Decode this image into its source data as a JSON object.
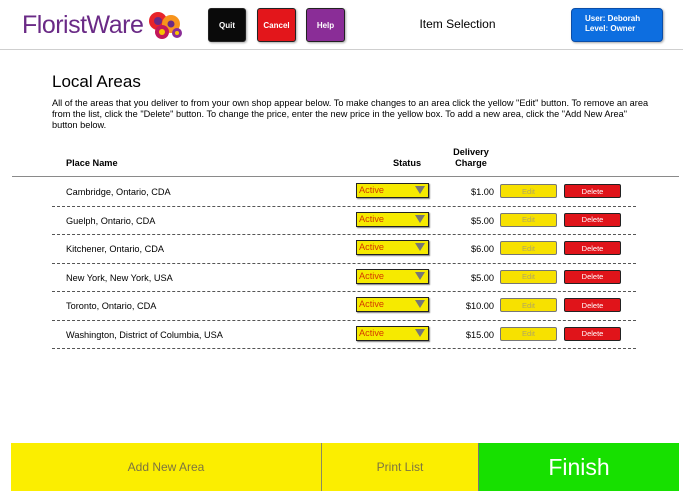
{
  "header": {
    "logo_text": "FloristWare",
    "quit_label": "Quit",
    "cancel_label": "Cancel",
    "help_label": "Help",
    "page_heading": "Item Selection",
    "user_line": "User: Deborah",
    "level_line": "Level: Owner"
  },
  "main": {
    "title": "Local Areas",
    "instructions": "All of the areas that you deliver to from your own shop appear below. To make changes to an area click the yellow \"Edit\" button. To remove an area from the list, click the \"Delete\" button. To change the price, enter the new price in the yellow box. To add a new area, click the \"Add New Area\" button below.",
    "columns": {
      "place": "Place Name",
      "status": "Status",
      "delivery_line1": "Delivery",
      "delivery_line2": "Charge"
    },
    "rows": [
      {
        "place": "Cambridge, Ontario, CDA",
        "status": "Active",
        "charge": "$1.00",
        "edit": "Edit",
        "delete": "Delete"
      },
      {
        "place": "Guelph, Ontario, CDA",
        "status": "Active",
        "charge": "$5.00",
        "edit": "Edit",
        "delete": "Delete"
      },
      {
        "place": "Kitchener, Ontario, CDA",
        "status": "Active",
        "charge": "$6.00",
        "edit": "Edit",
        "delete": "Delete"
      },
      {
        "place": "New York, New York, USA",
        "status": "Active",
        "charge": "$5.00",
        "edit": "Edit",
        "delete": "Delete"
      },
      {
        "place": "Toronto, Ontario, CDA",
        "status": "Active",
        "charge": "$10.00",
        "edit": "Edit",
        "delete": "Delete"
      },
      {
        "place": "Washington, District of Columbia, USA",
        "status": "Active",
        "charge": "$15.00",
        "edit": "Edit",
        "delete": "Delete"
      }
    ]
  },
  "footer": {
    "add_label": "Add New Area",
    "print_label": "Print List",
    "finish_label": "Finish"
  },
  "colors": {
    "brand_purple": "#6a2a86",
    "quit": "#0a0a0a",
    "cancel": "#e3161b",
    "help": "#8a2d97",
    "user_box": "#0d6ee0",
    "yellow": "#fbee00",
    "finish_green": "#17e000",
    "delete_red": "#e0141a"
  },
  "icons": {
    "logo_flowers": "flowers-icon",
    "dropdown": "chevron-down-icon"
  }
}
